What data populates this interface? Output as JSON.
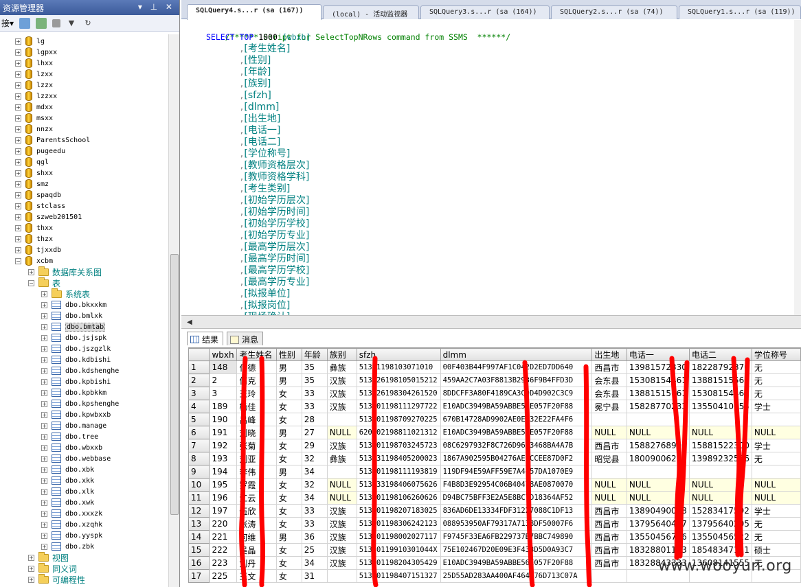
{
  "object_explorer": {
    "title": "资源管理器",
    "title_controls": "▾ ⊥ ✕",
    "toolbar": {
      "connect_label": "接▾"
    },
    "databases": [
      "lg",
      "lgpxx",
      "lhxx",
      "lzxx",
      "lzzx",
      "lzzxx",
      "mdxx",
      "msxx",
      "nnzx",
      "ParentsSchool",
      "pugeedu",
      "qgl",
      "shxx",
      "smz",
      "spaqdb",
      "stclass",
      "szweb201501",
      "thxx",
      "thzx",
      "tjxxdb",
      "xcbm"
    ],
    "xcbm_children": {
      "diagrams": "数据库关系图",
      "tables": "表",
      "system_tables": "系统表"
    },
    "tables": [
      "dbo.bkxxkm",
      "dbo.bmlxk",
      "dbo.bmtab",
      "dbo.jsjspk",
      "dbo.jszgzlk",
      "dbo.kdbishi",
      "dbo.kdshenghe",
      "dbo.kpbishi",
      "dbo.kpbkkm",
      "dbo.kpshenghe",
      "dbo.kpwbxxb",
      "dbo.manage",
      "dbo.tree",
      "dbo.wbxxb",
      "dbo.webbase",
      "dbo.xbk",
      "dbo.xkk",
      "dbo.xlk",
      "dbo.xwk",
      "dbo.xxxzk",
      "dbo.xzqhk",
      "dbo.yyspk",
      "dbo.zbk"
    ],
    "after_tables": [
      "视图",
      "同义词",
      "可编程性"
    ]
  },
  "tabs": [
    "SQLQuery4.s...r (sa (167))",
    "(local) - 活动监视器",
    "SQLQuery3.s...r (sa (164))",
    "SQLQuery2.s...r (sa (74))",
    "SQLQuery1.s...r (sa (119))"
  ],
  "editor": {
    "comment": "/****** Script for SelectTopNRows command from SSMS  ******/",
    "select_kw": "SELECT",
    "top_kw": "TOP",
    "top_num": "1000",
    "first_col": "[wbxh]",
    "columns": [
      "[考生姓名]",
      "[性别]",
      "[年龄]",
      "[族别]",
      "[sfzh]",
      "[dlmm]",
      "[出生地]",
      "[电话一]",
      "[电话二]",
      "[学位称号]",
      "[教师资格层次]",
      "[教师资格学科]",
      "[考生类别]",
      "[初始学历层次]",
      "[初始学历时间]",
      "[初始学历学校]",
      "[初始学历专业]",
      "[最高学历层次]",
      "[最高学历时间]",
      "[最高学历学校]",
      "[最高学历专业]",
      "[拟报单位]",
      "[拟报岗位]",
      "[现场确认]"
    ]
  },
  "results": {
    "tab_results": "结果",
    "tab_messages": "消息",
    "headers": [
      "wbxh",
      "考生姓名",
      "性别",
      "年龄",
      "族别",
      "sfzh",
      "dlmm",
      "出生地",
      "电话一",
      "电话二",
      "学位称号"
    ],
    "rows": [
      [
        "1",
        "148",
        "付德",
        "男",
        "35",
        "彝族",
        "51301198103071010",
        "00F403B44F997AF1C042D2ED7DD640",
        "西昌市",
        "13981572330",
        "18228792370",
        "无"
      ],
      [
        "2",
        "2",
        "何克",
        "男",
        "35",
        "汉族",
        "51322619810501521​2",
        "459AA2C7A03F8813B2936F9B4FFD3D",
        "会东县",
        "15308154461",
        "13881515561",
        "无"
      ],
      [
        "3",
        "3",
        "王玲",
        "女",
        "33",
        "汉族",
        "51322619830426152​0",
        "8DDCFF3A80F4189CA3C9D4D902C3C9",
        "会东县",
        "13881515661",
        "15308154461",
        "无"
      ],
      [
        "4",
        "189",
        "杨佳",
        "女",
        "33",
        "汉族",
        "51340119811129772​2",
        "E10ADC3949BA59ABBE56E057F20F88",
        "冕宁县",
        "15828770233",
        "13550410555",
        "学士"
      ],
      [
        "5",
        "190",
        "吕峰",
        "女",
        "28",
        "",
        "51340119870927022​5",
        "670B14728AD9902AE0EA32E22FA4F6",
        "",
        "",
        "",
        ""
      ],
      [
        "6",
        "191",
        "刘晓",
        "男",
        "27",
        "NULL",
        "62010219881102131​2",
        "E10ADC3949BA59ABBE56E057F20F88",
        "NULL",
        "NULL",
        "NULL",
        "NULL"
      ],
      [
        "7",
        "192",
        "张菊",
        "女",
        "29",
        "汉族",
        "51340119870324572​3",
        "08C6297932F8C726D96A3468BA4A7B",
        "西昌市",
        "15882768900",
        "15881522300",
        "学士"
      ],
      [
        "8",
        "193",
        "刘亚",
        "女",
        "32",
        "彝族",
        "51343119840520002​3",
        "1867A902595B04276AEECCEE87D0F2",
        "昭觉县",
        "18009006255",
        "13989232566",
        "无"
      ],
      [
        "9",
        "194",
        "李伟",
        "男",
        "34",
        "",
        "51340119811119381​9",
        "119DF94E59AFF59E7A4457DA1070E9",
        "",
        "",
        "",
        ""
      ],
      [
        "10",
        "195",
        "罗霞",
        "女",
        "32",
        "NULL",
        "51343319840607562​6",
        "F4B8D3E92954C06B40478AE0870070",
        "NULL",
        "NULL",
        "NULL",
        "NULL"
      ],
      [
        "11",
        "196",
        "江云",
        "女",
        "34",
        "NULL",
        "51340119810626062​6",
        "D94BC75BFF3E2A5E8BC7D18364AF52",
        "NULL",
        "NULL",
        "NULL",
        "NULL"
      ],
      [
        "12",
        "197",
        "伍欣",
        "女",
        "33",
        "汉族",
        "51340119820718302​5",
        "836AD6DE13334FDF31227088C1DF13",
        "西昌市",
        "13890490088",
        "15283417592",
        "学士"
      ],
      [
        "13",
        "220",
        "张涛",
        "女",
        "33",
        "汉族",
        "51340119830624212​3",
        "088953950AF79317A7138DF50007F6",
        "西昌市",
        "13795640407",
        "13795640205",
        "无"
      ],
      [
        "14",
        "221",
        "何维",
        "男",
        "36",
        "汉族",
        "51340119800202711​7",
        "F9745F33EA6FB229737B7BBC749890",
        "西昌市",
        "13550456776",
        "13550456522",
        "无"
      ],
      [
        "15",
        "222",
        "吴晶",
        "女",
        "25",
        "汉族",
        "51340119910301044X",
        "75E102467D20E09E3F433D5D0A93C7",
        "西昌市",
        "18328801123",
        "18548347121",
        "硕士"
      ],
      [
        "16",
        "223",
        "刘丹",
        "女",
        "34",
        "汉族",
        "51340119820430542​9",
        "E10ADC3949BA59ABBE56E057F20F88",
        "西昌市",
        "18328843333",
        "13608141555",
        "无"
      ],
      [
        "17",
        "225",
        "王文",
        "女",
        "31",
        "",
        "51340119840715132​7",
        "25D55AD283AA400AF464C76D713C07A",
        "",
        "",
        "",
        ""
      ]
    ]
  },
  "watermark": "www.wooyun.org",
  "colors": {
    "keyword": "#0000ff",
    "comment": "#008000",
    "identifier": "#008080",
    "null_bg": "#ffffe1",
    "redaction": "#ff0000"
  }
}
